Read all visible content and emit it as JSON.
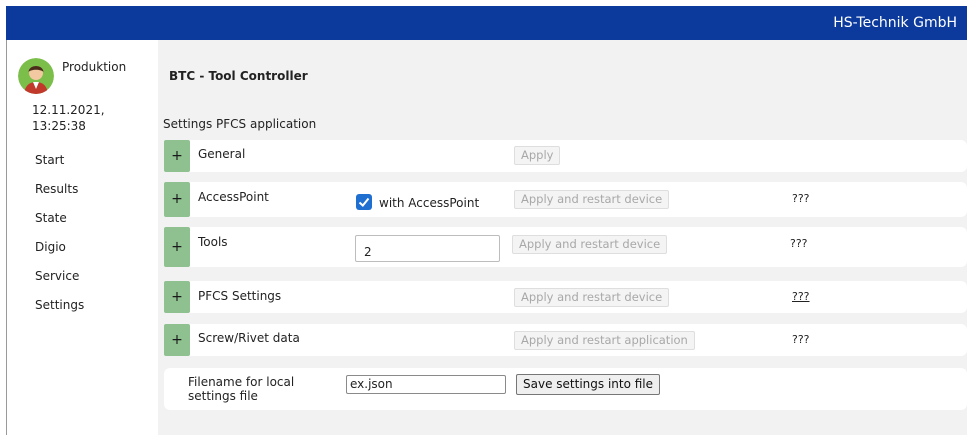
{
  "header": {
    "brand": "HS-Technik GmbH"
  },
  "user": {
    "name": "Produktion",
    "avatar_icon": "user-avatar-icon"
  },
  "datetime": {
    "date": "12.11.2021,",
    "time": "13:25:38"
  },
  "nav": {
    "items": [
      "Start",
      "Results",
      "State",
      "Digio",
      "Service",
      "Settings"
    ]
  },
  "main": {
    "app_title": "BTC - Tool Controller",
    "section_title": "Settings PFCS application"
  },
  "rows": {
    "general": {
      "toggle": "+",
      "label": "General",
      "button": "Apply"
    },
    "accesspoint": {
      "toggle": "+",
      "label": "AccessPoint",
      "checkbox_label": "with AccessPoint",
      "checked": true,
      "button": "Apply and restart device",
      "status": "???"
    },
    "tools": {
      "toggle": "+",
      "label": "Tools",
      "value": "2",
      "button": "Apply and restart device",
      "status": "???"
    },
    "pfcs": {
      "toggle": "+",
      "label": "PFCS Settings",
      "button": "Apply and restart device",
      "status": "???"
    },
    "screw": {
      "toggle": "+",
      "label": "Screw/Rivet data",
      "button": "Apply and restart application",
      "status": "???"
    }
  },
  "file": {
    "label_line1": "Filename for local",
    "label_line2": "settings file",
    "value": "ex.json",
    "button": "Save settings into file"
  },
  "colors": {
    "header": "#0b3a9c",
    "toggle": "#8fc08f",
    "checkbox": "#1f6fd1",
    "main_bg": "#f2f2f2"
  }
}
